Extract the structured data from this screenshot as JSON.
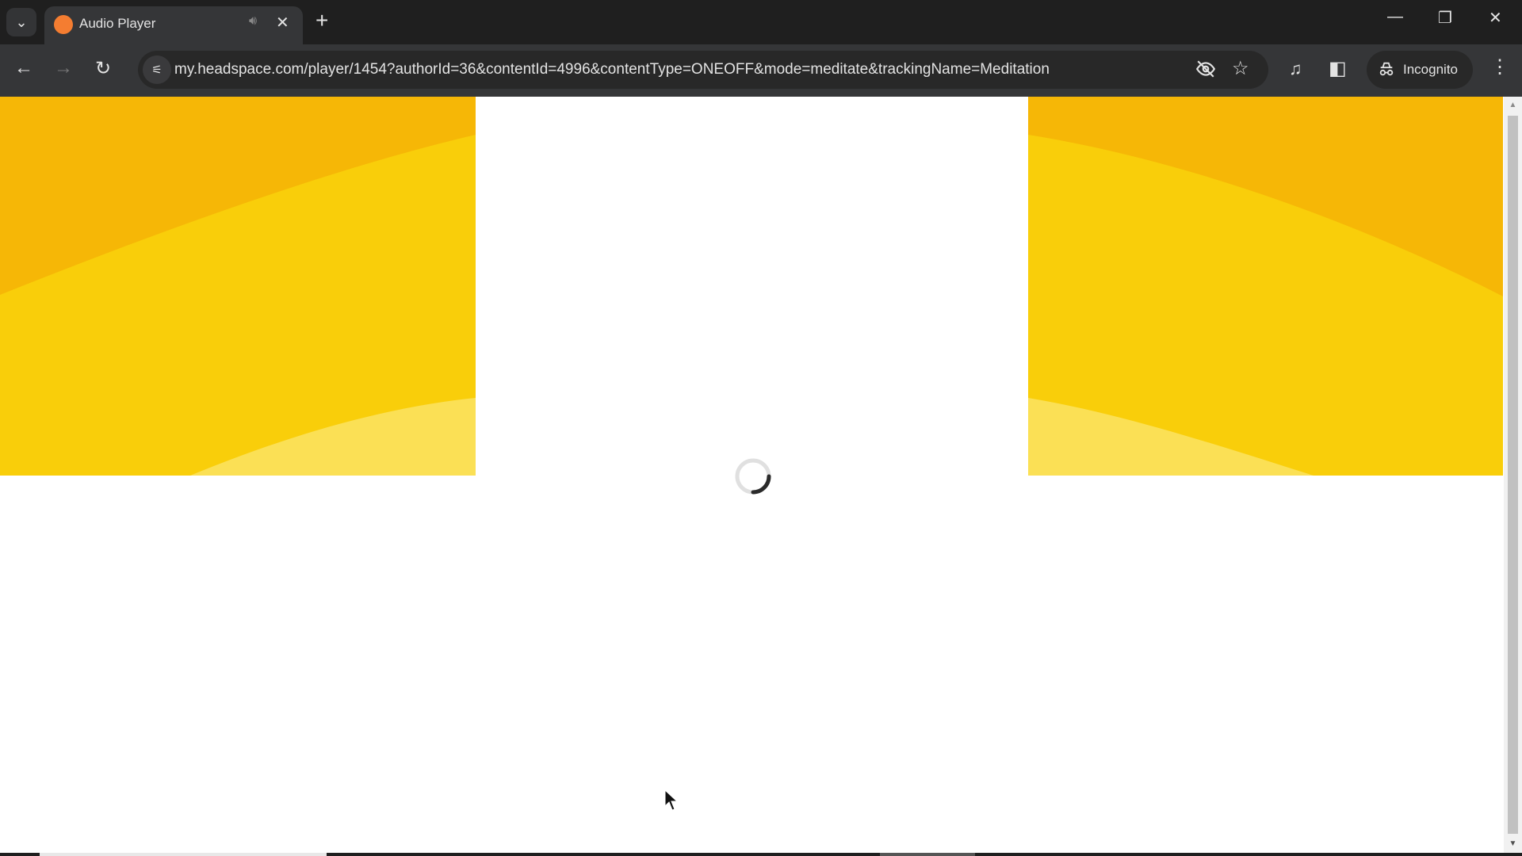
{
  "browser": {
    "tab": {
      "title": "Audio Player",
      "favicon_color": "#f47d31",
      "audio_icon": "speaker-icon",
      "close_icon": "close-icon"
    },
    "new_tab_icon": "+",
    "tab_search_icon": "⌄",
    "window_controls": {
      "minimize": "—",
      "restore": "❐",
      "close": "✕"
    },
    "nav": {
      "back": "←",
      "forward": "→",
      "reload": "↻"
    },
    "address_bar": {
      "site_info_icon": "⚟",
      "url": "my.headspace.com/player/1454?authorId=36&contentId=4996&contentType=ONEOFF&mode=meditate&trackingName=Meditation"
    },
    "omnibox_icons": {
      "tracking_protection": "◎",
      "bookmark": "☆"
    },
    "toolbar_icons": {
      "media_controls": "♫",
      "side_panel": "◧"
    },
    "incognito": {
      "label": "Incognito",
      "icon": "🕶"
    },
    "menu_icon": "⋮"
  },
  "page": {
    "state": "loading",
    "colors": {
      "yellow_dark": "#f6b706",
      "yellow_mid": "#f9ce0a",
      "yellow_light": "#fbe055",
      "background": "#ffffff"
    }
  },
  "scrollbar": {
    "up_arrow": "▲",
    "down_arrow": "▼"
  }
}
